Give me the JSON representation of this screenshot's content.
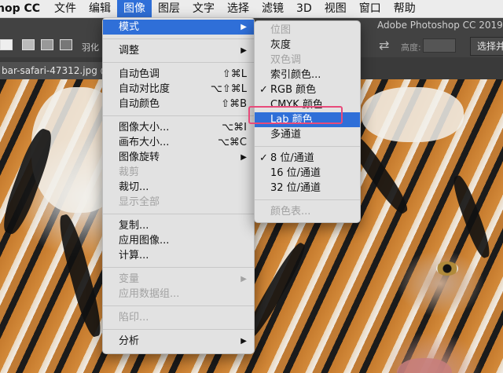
{
  "menubar": {
    "app": "hop CC",
    "items": [
      "文件",
      "编辑",
      "图像",
      "图层",
      "文字",
      "选择",
      "滤镜",
      "3D",
      "视图",
      "窗口",
      "帮助"
    ]
  },
  "window": {
    "title": "Adobe Photoshop CC 2019"
  },
  "optionsbar": {
    "feather": "羽化",
    "height_label": "高度:",
    "select_button": "选择并遮"
  },
  "document": {
    "tab": "bar-safari-47312.jpg @"
  },
  "image_menu": {
    "groups": [
      [
        {
          "label": "模式",
          "submenu": true,
          "active": true
        }
      ],
      [
        {
          "label": "调整",
          "submenu": true
        }
      ],
      [
        {
          "label": "自动色调",
          "shortcut": "⇧⌘L"
        },
        {
          "label": "自动对比度",
          "shortcut": "⌥⇧⌘L"
        },
        {
          "label": "自动颜色",
          "shortcut": "⇧⌘B"
        }
      ],
      [
        {
          "label": "图像大小...",
          "shortcut": "⌥⌘I"
        },
        {
          "label": "画布大小...",
          "shortcut": "⌥⌘C"
        },
        {
          "label": "图像旋转",
          "submenu": true
        },
        {
          "label": "裁剪",
          "disabled": true
        },
        {
          "label": "裁切..."
        },
        {
          "label": "显示全部",
          "disabled": true
        }
      ],
      [
        {
          "label": "复制..."
        },
        {
          "label": "应用图像..."
        },
        {
          "label": "计算..."
        }
      ],
      [
        {
          "label": "变量",
          "submenu": true,
          "disabled": true
        },
        {
          "label": "应用数据组...",
          "disabled": true
        }
      ],
      [
        {
          "label": "陷印...",
          "disabled": true
        }
      ],
      [
        {
          "label": "分析",
          "submenu": true
        }
      ]
    ]
  },
  "mode_submenu": {
    "groups": [
      [
        {
          "label": "位图",
          "disabled": true
        },
        {
          "label": "灰度"
        },
        {
          "label": "双色调",
          "disabled": true
        },
        {
          "label": "索引颜色..."
        },
        {
          "label": "RGB 颜色",
          "checked": true
        },
        {
          "label": "CMYK 颜色"
        },
        {
          "label": "Lab 颜色",
          "active": true
        },
        {
          "label": "多通道"
        }
      ],
      [
        {
          "label": "8 位/通道",
          "checked": true
        },
        {
          "label": "16 位/通道"
        },
        {
          "label": "32 位/通道"
        }
      ],
      [
        {
          "label": "颜色表...",
          "disabled": true
        }
      ]
    ]
  },
  "colors": {
    "accent": "#2f6fd8",
    "highlight_border": "#e84a7a",
    "menu_bg": "#e2e2e2"
  }
}
